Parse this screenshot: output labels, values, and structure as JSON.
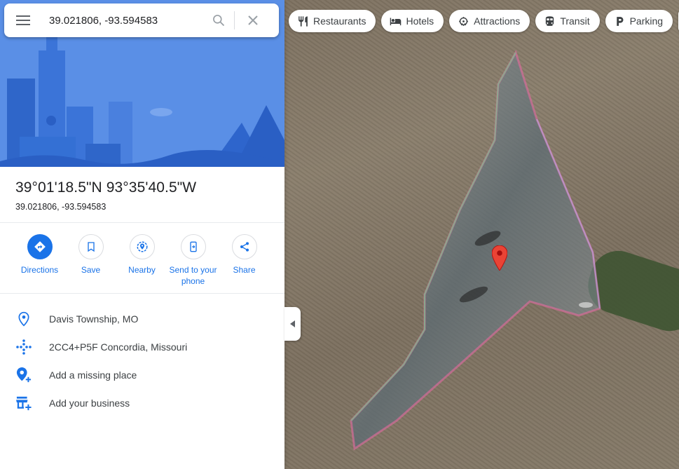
{
  "search": {
    "value": "39.021806, -93.594583",
    "menu_icon": "hamburger-menu-icon",
    "search_icon": "search-icon",
    "clear_icon": "close-icon"
  },
  "place": {
    "title": "39°01'18.5\"N 93°35'40.5\"W",
    "subtitle": "39.021806, -93.594583"
  },
  "actions": [
    {
      "label": "Directions",
      "icon": "directions-icon"
    },
    {
      "label": "Save",
      "icon": "bookmark-icon"
    },
    {
      "label": "Nearby",
      "icon": "nearby-icon"
    },
    {
      "label": "Send to your phone",
      "icon": "send-to-phone-icon"
    },
    {
      "label": "Share",
      "icon": "share-icon"
    }
  ],
  "info": [
    {
      "text": "Davis Township, MO",
      "icon": "location-pin-icon"
    },
    {
      "text": "2CC4+P5F Concordia, Missouri",
      "icon": "plus-code-icon"
    },
    {
      "text": "Add a missing place",
      "icon": "add-place-icon"
    },
    {
      "text": "Add your business",
      "icon": "add-business-icon"
    }
  ],
  "chips": [
    {
      "label": "Restaurants",
      "icon": "restaurant-icon"
    },
    {
      "label": "Hotels",
      "icon": "hotel-icon"
    },
    {
      "label": "Attractions",
      "icon": "attractions-icon"
    },
    {
      "label": "Transit",
      "icon": "transit-icon"
    },
    {
      "label": "Parking",
      "icon": "parking-icon"
    }
  ],
  "colors": {
    "accent": "#1a73e8",
    "pin": "#ea4335",
    "hero": "#4d86e3"
  }
}
